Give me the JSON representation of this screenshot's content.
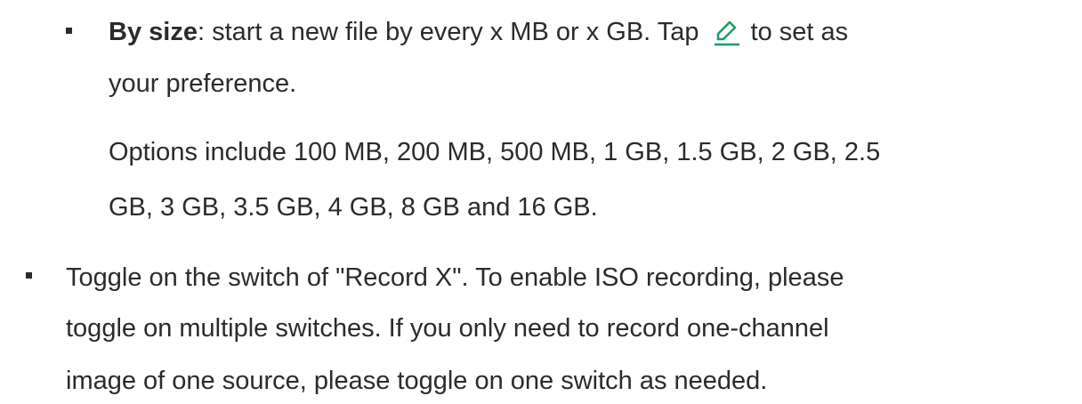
{
  "size_item": {
    "term": "By size",
    "line1_before_icon": ": start a new file by every x MB or x GB. Tap",
    "line1_after_icon": "to set as",
    "line2": "your preference.",
    "line3": "Options include 100 MB, 200 MB, 500 MB, 1 GB, 1.5 GB, 2 GB, 2.5",
    "line4": "GB, 3 GB, 3.5 GB, 4 GB, 8 GB and 16 GB.",
    "icon": "pencil-edit-icon",
    "icon_color": "#1a9e6a"
  },
  "record_item": {
    "line1": "Toggle on the switch of \"Record X\". To enable ISO recording, please",
    "line2": "toggle on multiple switches. If you only need to record one-channel",
    "line3": "image of one source, please toggle on one switch as needed."
  }
}
